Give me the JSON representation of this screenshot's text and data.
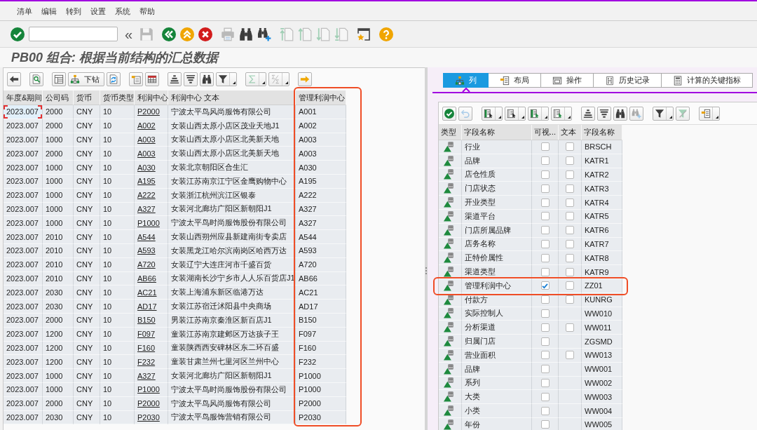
{
  "menu": [
    "清单",
    "编辑",
    "转到",
    "设置",
    "系统",
    "帮助"
  ],
  "toolbar": [
    [
      {
        "kind": "confirm",
        "disabled": false
      },
      {
        "kind": "field",
        "disabled": false
      },
      {
        "kind": "glyph",
        "label": "«",
        "disabled": false
      },
      {
        "kind": "save",
        "disabled": true
      }
    ],
    [
      {
        "kind": "back",
        "disabled": false
      },
      {
        "kind": "exit",
        "disabled": false
      },
      {
        "kind": "cancel",
        "disabled": false
      }
    ],
    [
      {
        "kind": "print",
        "disabled": true
      },
      {
        "kind": "find",
        "disabled": false
      },
      {
        "kind": "findnext",
        "disabled": false
      }
    ],
    [
      {
        "kind": "first",
        "disabled": true
      },
      {
        "kind": "prev",
        "disabled": true
      },
      {
        "kind": "next",
        "disabled": true
      },
      {
        "kind": "last",
        "disabled": true
      }
    ],
    [
      {
        "kind": "customize",
        "disabled": false
      }
    ],
    [
      {
        "kind": "help",
        "disabled": false
      }
    ]
  ],
  "title": "PB00 组合: 根据当前结构的汇总数据",
  "left_table": {
    "toolbar": [
      [
        {
          "kind": "left",
          "disabled": false
        }
      ],
      [
        {
          "kind": "details",
          "disabled": false
        }
      ],
      [
        {
          "kind": "list",
          "disabled": false
        },
        {
          "kind": "drill",
          "label": "下钻",
          "disabled": false
        },
        {
          "kind": "refresh",
          "disabled": false
        }
      ],
      [
        {
          "kind": "export",
          "disabled": false
        },
        {
          "kind": "sheet",
          "disabled": false
        }
      ],
      [
        {
          "kind": "sortasc",
          "disabled": false
        },
        {
          "kind": "sortdesc",
          "disabled": false
        },
        {
          "kind": "find",
          "disabled": false
        },
        {
          "kind": "filter",
          "disabled": false,
          "dropdown": true
        }
      ],
      [
        {
          "kind": "sum",
          "disabled": true,
          "dropdown": true
        },
        {
          "kind": "subtotal",
          "disabled": true,
          "dropdown": true
        }
      ],
      [
        {
          "kind": "right",
          "disabled": false
        }
      ]
    ],
    "columns": [
      {
        "label": "年度&期间",
        "kind": "text",
        "highlighted": false
      },
      {
        "label": "公司码",
        "kind": "text",
        "highlighted": false
      },
      {
        "label": "货币",
        "kind": "text",
        "highlighted": false
      },
      {
        "label": "货币类型",
        "kind": "text",
        "highlighted": false
      },
      {
        "label": "利润中心",
        "kind": "link",
        "highlighted": false
      },
      {
        "label": "利润中心 文本",
        "kind": "text",
        "highlighted": false
      },
      {
        "label": "管理利润中心",
        "kind": "text",
        "highlighted": true
      }
    ],
    "rows": [
      {
        "cells": [
          "2023.007",
          "2000",
          "CNY",
          "10",
          "P2000",
          "宁波太平鸟风尚服饰有限公司",
          "A001"
        ],
        "focused": true
      },
      {
        "cells": [
          "2023.007",
          "2000",
          "CNY",
          "10",
          "A002",
          "女装山西太原小店区茂业天地J1",
          "A002"
        ],
        "focused": false
      },
      {
        "cells": [
          "2023.007",
          "1000",
          "CNY",
          "10",
          "A003",
          "女装山西太原小店区北美新天地",
          "A003"
        ],
        "focused": false
      },
      {
        "cells": [
          "2023.007",
          "2000",
          "CNY",
          "10",
          "A003",
          "女装山西太原小店区北美新天地",
          "A003"
        ],
        "focused": false
      },
      {
        "cells": [
          "2023.007",
          "1000",
          "CNY",
          "10",
          "A030",
          "女装北京朝阳区合生汇",
          "A030"
        ],
        "focused": false
      },
      {
        "cells": [
          "2023.007",
          "1000",
          "CNY",
          "10",
          "A195",
          "女装江苏南京江宁区金鹰购物中心",
          "A195"
        ],
        "focused": false
      },
      {
        "cells": [
          "2023.007",
          "1000",
          "CNY",
          "10",
          "A222",
          "女装浙江杭州滨江区银泰",
          "A222"
        ],
        "focused": false
      },
      {
        "cells": [
          "2023.007",
          "1000",
          "CNY",
          "10",
          "A327",
          "女装河北廊坊广阳区新朝阳J1",
          "A327"
        ],
        "focused": false
      },
      {
        "cells": [
          "2023.007",
          "1000",
          "CNY",
          "10",
          "P1000",
          "宁波太平鸟时尚服饰股份有限公司",
          "A327"
        ],
        "focused": false
      },
      {
        "cells": [
          "2023.007",
          "2010",
          "CNY",
          "10",
          "A544",
          "女装山西朔州应县新建南街专卖店",
          "A544"
        ],
        "focused": false
      },
      {
        "cells": [
          "2023.007",
          "2010",
          "CNY",
          "10",
          "A593",
          "女装黑龙江哈尔滨南岗区哈西万达",
          "A593"
        ],
        "focused": false
      },
      {
        "cells": [
          "2023.007",
          "2010",
          "CNY",
          "10",
          "A720",
          "女装辽宁大连庄河市千盛百货",
          "A720"
        ],
        "focused": false
      },
      {
        "cells": [
          "2023.007",
          "2010",
          "CNY",
          "10",
          "AB66",
          "女装湖南长沙宁乡市人人乐百货店J1",
          "AB66"
        ],
        "focused": false
      },
      {
        "cells": [
          "2023.007",
          "2030",
          "CNY",
          "10",
          "AC21",
          "女装上海浦东新区临港万达",
          "AC21"
        ],
        "focused": false
      },
      {
        "cells": [
          "2023.007",
          "2030",
          "CNY",
          "10",
          "AD17",
          "女装江苏宿迁沭阳县中央商场",
          "AD17"
        ],
        "focused": false
      },
      {
        "cells": [
          "2023.007",
          "2000",
          "CNY",
          "10",
          "B150",
          "男装江苏南京秦淮区新百店J1",
          "B150"
        ],
        "focused": false
      },
      {
        "cells": [
          "2023.007",
          "1200",
          "CNY",
          "10",
          "F097",
          "童装江苏南京建邺区万达孩子王",
          "F097"
        ],
        "focused": false
      },
      {
        "cells": [
          "2023.007",
          "1200",
          "CNY",
          "10",
          "F160",
          "童装陕西西安碑林区东二环百盛",
          "F160"
        ],
        "focused": false
      },
      {
        "cells": [
          "2023.007",
          "1200",
          "CNY",
          "10",
          "F232",
          "童装甘肃兰州七里河区兰州中心",
          "F232"
        ],
        "focused": false
      },
      {
        "cells": [
          "2023.007",
          "1000",
          "CNY",
          "10",
          "A327",
          "女装河北廊坊广阳区新朝阳J1",
          "P1000"
        ],
        "focused": false
      },
      {
        "cells": [
          "2023.007",
          "1000",
          "CNY",
          "10",
          "P1000",
          "宁波太平鸟时尚服饰股份有限公司",
          "P1000"
        ],
        "focused": false
      },
      {
        "cells": [
          "2023.007",
          "2000",
          "CNY",
          "10",
          "P2000",
          "宁波太平鸟风尚服饰有限公司",
          "P2000"
        ],
        "focused": false
      },
      {
        "cells": [
          "2023.007",
          "2030",
          "CNY",
          "10",
          "P2030",
          "宁波太平鸟服饰营销有限公司",
          "P2030"
        ],
        "focused": false
      }
    ]
  },
  "right_panel": {
    "tabs": [
      {
        "label": "列",
        "kind": "columns",
        "selected": true
      },
      {
        "label": "布局",
        "kind": "layout",
        "selected": false
      },
      {
        "label": "操作",
        "kind": "actions",
        "selected": false
      },
      {
        "label": "历史记录",
        "kind": "history",
        "selected": false
      },
      {
        "label": "计算的关键指标",
        "kind": "calc",
        "selected": false
      }
    ],
    "toolbar": [
      [
        {
          "kind": "confirm",
          "disabled": false
        },
        {
          "kind": "undo",
          "disabled": true
        }
      ],
      [
        {
          "kind": "markall",
          "disabled": false,
          "dropdown": true
        },
        {
          "kind": "unmarkall",
          "disabled": false,
          "dropdown": true
        },
        {
          "kind": "mark",
          "disabled": false,
          "dropdown": true
        },
        {
          "kind": "move",
          "disabled": false,
          "dropdown": true
        }
      ],
      [
        {
          "kind": "sortasc",
          "disabled": false
        },
        {
          "kind": "sortdesc",
          "disabled": false
        },
        {
          "kind": "find",
          "disabled": false
        },
        {
          "kind": "findnext",
          "disabled": true
        }
      ],
      [
        {
          "kind": "filter",
          "disabled": false,
          "dropdown": true
        },
        {
          "kind": "unfilter",
          "disabled": true
        }
      ],
      [
        {
          "kind": "layout",
          "disabled": false,
          "dropdown": true
        }
      ]
    ],
    "columns": [
      "类型",
      "字段名称",
      "可视...",
      "文本",
      "字段名称"
    ],
    "rows": [
      {
        "name": "行业",
        "visible": false,
        "text": false,
        "field": "BRSCH",
        "highlighted": false
      },
      {
        "name": "品牌",
        "visible": false,
        "text": false,
        "field": "KATR1",
        "highlighted": false
      },
      {
        "name": "店仓性质",
        "visible": false,
        "text": false,
        "field": "KATR2",
        "highlighted": false
      },
      {
        "name": "门店状态",
        "visible": false,
        "text": false,
        "field": "KATR3",
        "highlighted": false
      },
      {
        "name": "开业类型",
        "visible": false,
        "text": false,
        "field": "KATR4",
        "highlighted": false
      },
      {
        "name": "渠道平台",
        "visible": false,
        "text": false,
        "field": "KATR5",
        "highlighted": false
      },
      {
        "name": "门店所属品牌",
        "visible": false,
        "text": false,
        "field": "KATR6",
        "highlighted": false
      },
      {
        "name": "店务名称",
        "visible": false,
        "text": false,
        "field": "KATR7",
        "highlighted": false
      },
      {
        "name": "正特价属性",
        "visible": false,
        "text": false,
        "field": "KATR8",
        "highlighted": false
      },
      {
        "name": "渠道类型",
        "visible": false,
        "text": false,
        "field": "KATR9",
        "highlighted": false
      },
      {
        "name": "管理利润中心",
        "visible": true,
        "text": false,
        "field": "ZZ01",
        "highlighted": true
      },
      {
        "name": "付款方",
        "visible": false,
        "text": false,
        "field": "KUNRG",
        "highlighted": false
      },
      {
        "name": "实际控制人",
        "visible": false,
        "field": "WW010",
        "highlighted": false
      },
      {
        "name": "分析渠道",
        "visible": false,
        "text": false,
        "field": "WW011",
        "highlighted": false
      },
      {
        "name": "归属门店",
        "visible": false,
        "field": "ZGSMD",
        "highlighted": false
      },
      {
        "name": "营业面积",
        "visible": false,
        "text": false,
        "field": "WW013",
        "highlighted": false
      },
      {
        "name": "品牌",
        "visible": false,
        "field": "WW001",
        "highlighted": false
      },
      {
        "name": "系列",
        "visible": false,
        "field": "WW002",
        "highlighted": false
      },
      {
        "name": "大类",
        "visible": false,
        "field": "WW003",
        "highlighted": false
      },
      {
        "name": "小类",
        "visible": false,
        "field": "WW004",
        "highlighted": false
      },
      {
        "name": "年份",
        "visible": false,
        "field": "WW005",
        "highlighted": false
      }
    ]
  }
}
